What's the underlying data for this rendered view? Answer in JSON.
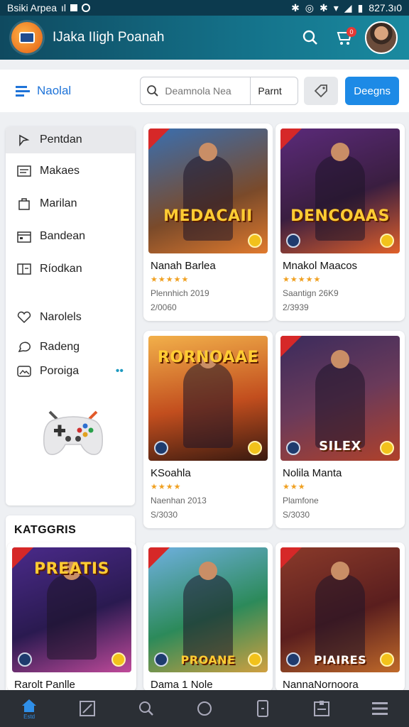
{
  "status": {
    "carrier": "Bsiki Arpea",
    "signal": "ıl",
    "time": "827.3ı0"
  },
  "app": {
    "title": "IJaka IIigh Poanah",
    "notification_count": "0"
  },
  "toolbar": {
    "nav_label": "Naolal",
    "search_placeholder": "Deamnola Nea",
    "search_button": "Parnt",
    "primary_button": "Deegns"
  },
  "sidebar": {
    "items": [
      {
        "label": "Pentdan",
        "icon": "cursor-icon"
      },
      {
        "label": "Makaes",
        "icon": "list-icon"
      },
      {
        "label": "Marilan",
        "icon": "bag-icon"
      },
      {
        "label": "Bandean",
        "icon": "calendar-icon"
      },
      {
        "label": "Ríodkan",
        "icon": "grid-icon"
      },
      {
        "label": "Narolels",
        "icon": "heart-icon"
      },
      {
        "label": "Radeng",
        "icon": "chat-icon"
      },
      {
        "label": "Poroiga",
        "icon": "image-icon",
        "extra": "••"
      }
    ]
  },
  "categories": {
    "title": "KATGGRIS"
  },
  "cards": [
    {
      "name": "Nanah Barlea",
      "meta1": "Plennhich 2019",
      "meta2": "2/0060",
      "art_title": "MEDACAII",
      "colors": [
        "#3a6fb0",
        "#e07a2e"
      ]
    },
    {
      "name": "Mnakol Maacos",
      "meta1": "Saantign 26K9",
      "meta2": "2/3939",
      "art_title": "DENCOAAS",
      "colors": [
        "#5b2a7a",
        "#e0602a"
      ]
    },
    {
      "name": "KSoahla",
      "meta1": "Naenhan 2013",
      "meta2": "S/3030",
      "art_title": "RORNOAAE",
      "colors": [
        "#c24e1e",
        "#f2b04a"
      ]
    },
    {
      "name": "Nolila Manta",
      "meta1": "Plamfone",
      "meta2": "S/3030",
      "art_title": "SILEX",
      "colors": [
        "#3b2b5c",
        "#b0412a"
      ]
    },
    {
      "name": "Rarolt Panlle",
      "meta1": "",
      "meta2": "",
      "art_title": "PREATIS",
      "colors": [
        "#4a2a8a",
        "#c04a9a"
      ]
    },
    {
      "name": "Dama 1 Nole",
      "meta1": "",
      "meta2": "",
      "art_title": "PROANE",
      "colors": [
        "#2c8a5a",
        "#d0a040"
      ]
    },
    {
      "name": "NannaNornoora",
      "meta1": "",
      "meta2": "",
      "art_title": "PIAIRES",
      "colors": [
        "#5a1e1e",
        "#c06a2a"
      ]
    }
  ],
  "bottom_nav": [
    {
      "name": "home",
      "label": "Estd"
    },
    {
      "name": "edit",
      "label": ""
    },
    {
      "name": "search",
      "label": ""
    },
    {
      "name": "circle",
      "label": ""
    },
    {
      "name": "phone",
      "label": ""
    },
    {
      "name": "library",
      "label": ""
    },
    {
      "name": "menu",
      "label": ""
    }
  ]
}
